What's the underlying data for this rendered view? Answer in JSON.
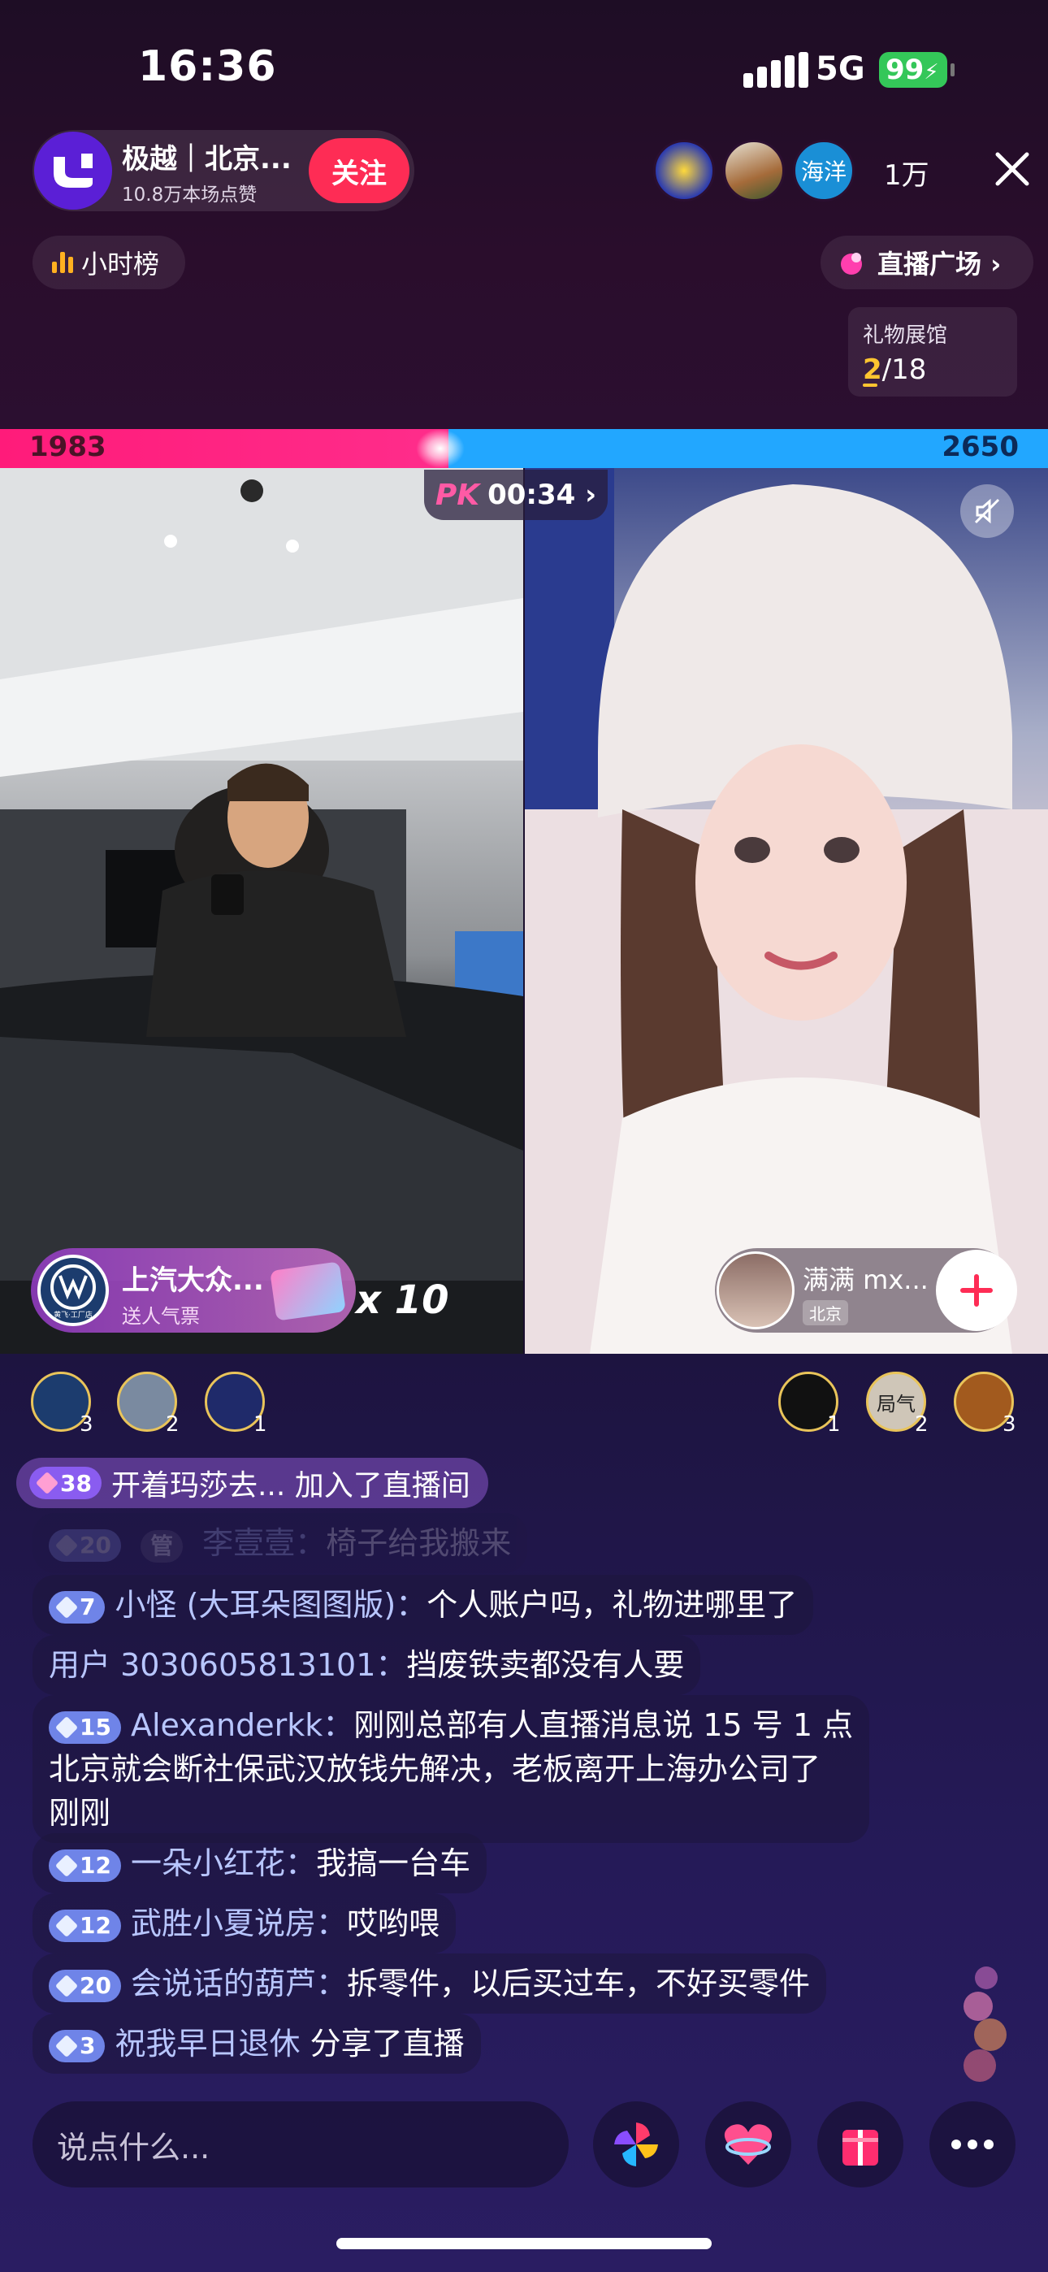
{
  "status_bar": {
    "time": "16:36",
    "network": "5G",
    "battery": "99"
  },
  "host": {
    "name": "极越｜北京...",
    "likes": "10.8万本场点赞",
    "follow_label": "关注"
  },
  "viewers": {
    "count": "1万",
    "badge_text": "海洋"
  },
  "ranking": {
    "label": "小时榜"
  },
  "plaza": {
    "label": "直播广场 ›"
  },
  "gift_hall": {
    "title": "礼物展馆",
    "current": "2",
    "total": "/18"
  },
  "pk": {
    "left_score": "1983",
    "right_score": "2650",
    "left_fraction": 0.428,
    "timer_prefix": "PK",
    "timer": "00:34 ›"
  },
  "sponsor": {
    "name": "上汽大众...",
    "sub": "送人气票",
    "multiplier": "x 10",
    "logo_caption": "黄飞·工厂店"
  },
  "guest": {
    "name": "满满 mx...",
    "location": "北京"
  },
  "contributors_left": [
    {
      "rank": "3",
      "color": "#1c3c6e"
    },
    {
      "rank": "2",
      "color": "#7a8aa0"
    },
    {
      "rank": "1",
      "color": "#1f2a6a"
    }
  ],
  "contributors_right": [
    {
      "rank": "1",
      "color": "#111111"
    },
    {
      "rank": "2",
      "color": "#cfc6b8",
      "text": "局气"
    },
    {
      "rank": "3",
      "color": "#a25a1e"
    }
  ],
  "chat": {
    "join_notice": {
      "level": "38",
      "text": "开着玛莎去... 加入了直播间"
    },
    "faded_line": {
      "level": "20",
      "tag": "管",
      "user": "李壹壹：",
      "message": "椅子给我搬来"
    },
    "messages": [
      {
        "level": "7",
        "user": "小怪 (大耳朵图图版)：",
        "message": "个人账户吗，礼物进哪里了"
      },
      {
        "level": "",
        "user": "用户 3030605813101：",
        "message": "挡废铁卖都没有人要"
      },
      {
        "level": "15",
        "user": "Alexanderkk：",
        "message": "刚刚总部有人直播消息说 15 号 1 点",
        "line2": "北京就会断社保武汉放钱先解决，老板离开上海办公司了",
        "line3": "刚刚"
      },
      {
        "level": "12",
        "user": "一朵小红花：",
        "message": "我搞一台车"
      },
      {
        "level": "12",
        "user": "武胜小夏说房：",
        "message": "哎哟喂"
      },
      {
        "level": "20",
        "user": "会说话的葫芦：",
        "message": "拆零件，以后买过车，不好买零件"
      },
      {
        "level": "3",
        "user": "祝我早日退休",
        "message": " 分享了直播"
      }
    ]
  },
  "input": {
    "placeholder": "说点什么..."
  },
  "icons": [
    "pinwheel-icon",
    "heart-icon",
    "gift-icon",
    "more-icon"
  ],
  "colors": {
    "follow": "#fe2c55",
    "pk_red": "#ff1b7a",
    "pk_blue": "#22a7ff",
    "battery": "#34c759"
  }
}
